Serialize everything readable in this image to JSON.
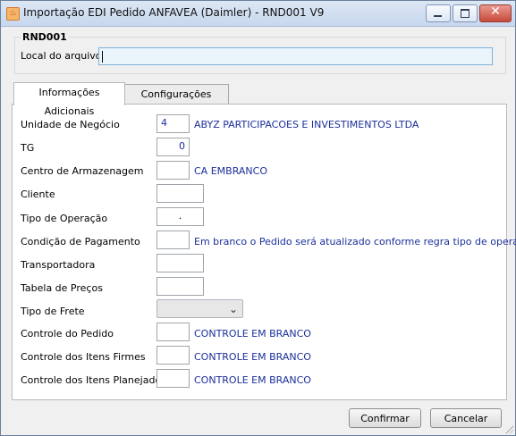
{
  "window": {
    "app_icon_glyph": "♨",
    "title": "Importação EDI Pedido ANFAVEA (Daimler) - RND001 V9",
    "minimize_glyph": "",
    "maximize_glyph": "",
    "close_glyph": "✕"
  },
  "file_group": {
    "title": "RND001",
    "label": "Local do arquivo",
    "value": ""
  },
  "tabs": [
    {
      "label": "Informações Adicionais",
      "active": true
    },
    {
      "label": "Configurações",
      "active": false
    }
  ],
  "form": {
    "unidade_negocio": {
      "label": "Unidade de Negócio",
      "value": "4",
      "description": "ABYZ PARTICIPACOES E INVESTIMENTOS LTDA"
    },
    "tg": {
      "label": "TG",
      "value": "0"
    },
    "centro_armazenagem": {
      "label": "Centro de Armazenagem",
      "value": "",
      "description": "CA EMBRANCO"
    },
    "cliente": {
      "label": "Cliente",
      "value": ""
    },
    "tipo_operacao": {
      "label": "Tipo de Operação",
      "value": "."
    },
    "condicao_pagamento": {
      "label": "Condição de Pagamento",
      "value": "",
      "description": "Em branco o Pedido será atualizado conforme regra tipo de operação"
    },
    "transportadora": {
      "label": "Transportadora",
      "value": ""
    },
    "tabela_precos": {
      "label": "Tabela de Preços",
      "value": ""
    },
    "tipo_frete": {
      "label": "Tipo de Frete",
      "value": ""
    },
    "controle_pedido": {
      "label": "Controle do Pedido",
      "value": "",
      "description": "CONTROLE EM BRANCO"
    },
    "controle_itens_firmes": {
      "label": "Controle dos Itens Firmes",
      "value": "",
      "description": "CONTROLE EM BRANCO"
    },
    "controle_itens_planejados": {
      "label": "Controle dos Itens Planejados",
      "value": "",
      "description": "CONTROLE EM BRANCO"
    }
  },
  "buttons": {
    "confirm": "Confirmar",
    "cancel": "Cancelar"
  },
  "icons": {
    "dropdown": "chevron-down-icon"
  }
}
